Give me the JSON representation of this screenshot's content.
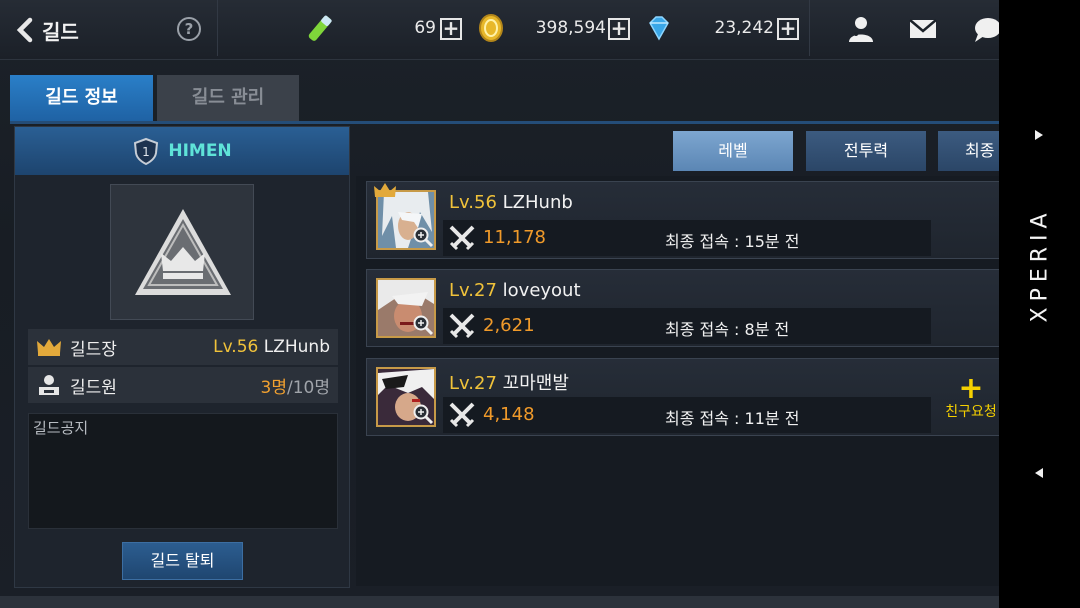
{
  "topbar": {
    "back_label": "길드",
    "help_symbol": "?",
    "stamina": "69",
    "gold": "398,594",
    "gems": "23,242",
    "plus_symbol": "+"
  },
  "tabs": [
    {
      "label": "길드 정보",
      "active": true
    },
    {
      "label": "길드 관리",
      "active": false
    }
  ],
  "guild": {
    "rank_badge": "1",
    "name": "HIMEN",
    "leader_label": "길드장",
    "leader_level": "Lv.56",
    "leader_name": "LZHunb",
    "members_label": "길드원",
    "members_count": "3명",
    "members_max": "/10명",
    "notice_label": "길드공지",
    "leave_button": "길드 탈퇴"
  },
  "sort_buttons": [
    {
      "label": "레벨",
      "active": true
    },
    {
      "label": "전투력",
      "active": false
    },
    {
      "label": "최종",
      "active": false
    }
  ],
  "members": [
    {
      "level": "Lv.56",
      "name": "LZHunb",
      "power": "11,178",
      "last_login": "최종 접속 : 15분 전",
      "is_leader": true,
      "friend_request": ""
    },
    {
      "level": "Lv.27",
      "name": "loveyout",
      "power": "2,621",
      "last_login": "최종 접속 : 8분 전",
      "is_leader": false,
      "friend_request": ""
    },
    {
      "level": "Lv.27",
      "name": "꼬마맨발",
      "power": "4,148",
      "last_login": "최종 접속 : 11분 전",
      "is_leader": false,
      "friend_request": "친구요청",
      "friend_plus": "+"
    }
  ],
  "device": {
    "brand": "XPERIA"
  },
  "colors": {
    "accent_blue": "#2a7fc8",
    "gold_text": "#f0c23a",
    "power_orange": "#f09a2a",
    "friend_yellow": "#f5d000",
    "guild_name_cyan": "#5fe3d8"
  }
}
